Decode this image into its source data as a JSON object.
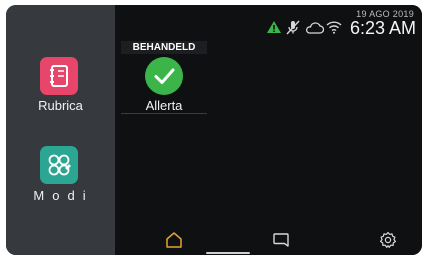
{
  "sidebar": {
    "apps": [
      {
        "label": "Rubrica",
        "icon": "address-book-icon",
        "color": "#e8456b"
      },
      {
        "label": "Modi",
        "icon": "modes-grid-icon",
        "color": "#2aa693"
      }
    ]
  },
  "status": {
    "date": "19 AGO 2019",
    "time": "6:23 AM",
    "icons": [
      "warning-icon",
      "mic-off-icon",
      "cloud-icon",
      "wifi-icon"
    ],
    "warning_color": "#3bb54a"
  },
  "main": {
    "tile": {
      "heading": "BEHANDELD",
      "label": "Allerta",
      "icon": "check-circle-icon",
      "color": "#3bb54a"
    }
  },
  "navbar": {
    "items": [
      {
        "icon": "home-icon",
        "active": true,
        "color": "#e0a23a"
      },
      {
        "icon": "chat-icon",
        "active": false
      },
      {
        "icon": "settings-icon",
        "active": false
      }
    ]
  }
}
